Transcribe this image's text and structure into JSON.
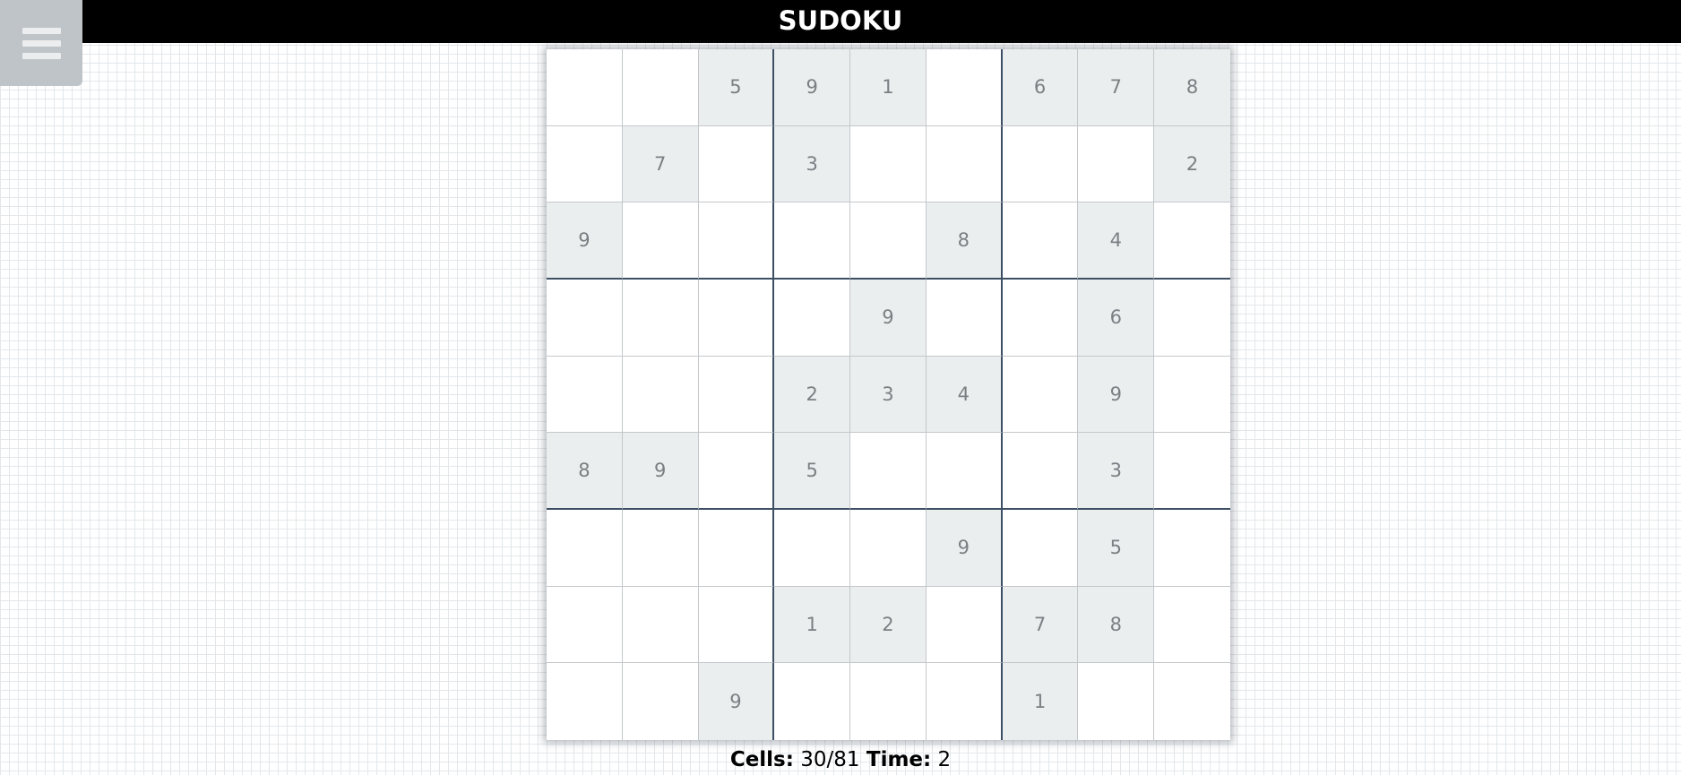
{
  "header": {
    "title": "SUDOKU"
  },
  "menu": {
    "icon": "hamburger-menu-icon"
  },
  "board": {
    "rows": [
      [
        "",
        "",
        "5",
        "9",
        "1",
        "",
        "6",
        "7",
        "8"
      ],
      [
        "",
        "7",
        "",
        "3",
        "",
        "",
        "",
        "",
        "2"
      ],
      [
        "9",
        "",
        "",
        "",
        "",
        "8",
        "",
        "4",
        ""
      ],
      [
        "",
        "",
        "",
        "",
        "9",
        "",
        "",
        "6",
        ""
      ],
      [
        "",
        "",
        "",
        "2",
        "3",
        "4",
        "",
        "9",
        ""
      ],
      [
        "8",
        "9",
        "",
        "5",
        "",
        "",
        "",
        "3",
        ""
      ],
      [
        "",
        "",
        "",
        "",
        "",
        "9",
        "",
        "5",
        ""
      ],
      [
        "",
        "",
        "",
        "1",
        "2",
        "",
        "7",
        "8",
        ""
      ],
      [
        "",
        "",
        "9",
        "",
        "",
        "",
        "1",
        "",
        ""
      ]
    ]
  },
  "status": {
    "cells_label": "Cells:",
    "cells_value": "30/81",
    "time_label": "Time:",
    "time_value": "2"
  }
}
